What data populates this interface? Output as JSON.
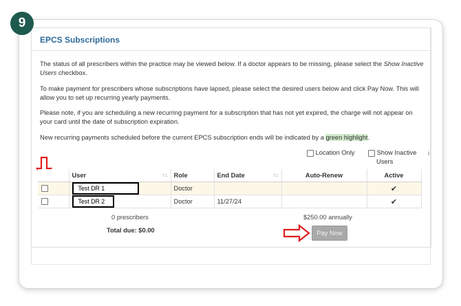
{
  "step": "9",
  "panel": {
    "title": "EPCS Subscriptions",
    "para1_a": "The status of all prescribers within the practice may be viewed below. If a doctor appears to be missing, please select the ",
    "para1_italic": "Show Inactive Users",
    "para1_b": " checkbox.",
    "para2": "To make payment for prescribers whose subscriptions have lapsed, please select the desired users below and click Pay Now. This will allow you to set up recurring yearly payments.",
    "para3": "Please note, if you are scheduling a new recurring payment for a subscription that has not yet expired, the charge will not appear on your card until the date of subscription expiration.",
    "para4_a": "New recurring payments scheduled before the current EPCS subscription ends will be indicated by a ",
    "para4_highlight": "green highlight",
    "para4_b": "."
  },
  "filters": {
    "location_only": "Location Only",
    "show_inactive_line1": "Show Inactive",
    "show_inactive_line2": "Users"
  },
  "table": {
    "headers": {
      "user": "User",
      "role": "Role",
      "end_date": "End Date",
      "auto_renew": "Auto-Renew",
      "active": "Active"
    },
    "rows": [
      {
        "user": "Test DR 1",
        "role": "Doctor",
        "end_date": "",
        "auto_renew": "",
        "active": "✔"
      },
      {
        "user": "Test DR 2",
        "role": "Doctor",
        "end_date": "11/27/24",
        "auto_renew": "",
        "active": "✔"
      }
    ]
  },
  "summary": {
    "prescribers": "0 prescribers",
    "total_due": "Total due: $0.00",
    "annual": "$250.00 annually",
    "pay_now": "Pay Now"
  },
  "stray_mark": "i",
  "colors": {
    "badge": "#1f5a4f",
    "title": "#2f6b9a",
    "highlight": "#cfe9c9",
    "arrow": "#e01e1e",
    "button": "#a9a9a9"
  },
  "icons": {
    "sort": "sort-arrows-icon",
    "check": "checkmark-icon",
    "arrow_down": "red-down-arrow-icon",
    "arrow_right": "red-right-arrow-icon"
  }
}
